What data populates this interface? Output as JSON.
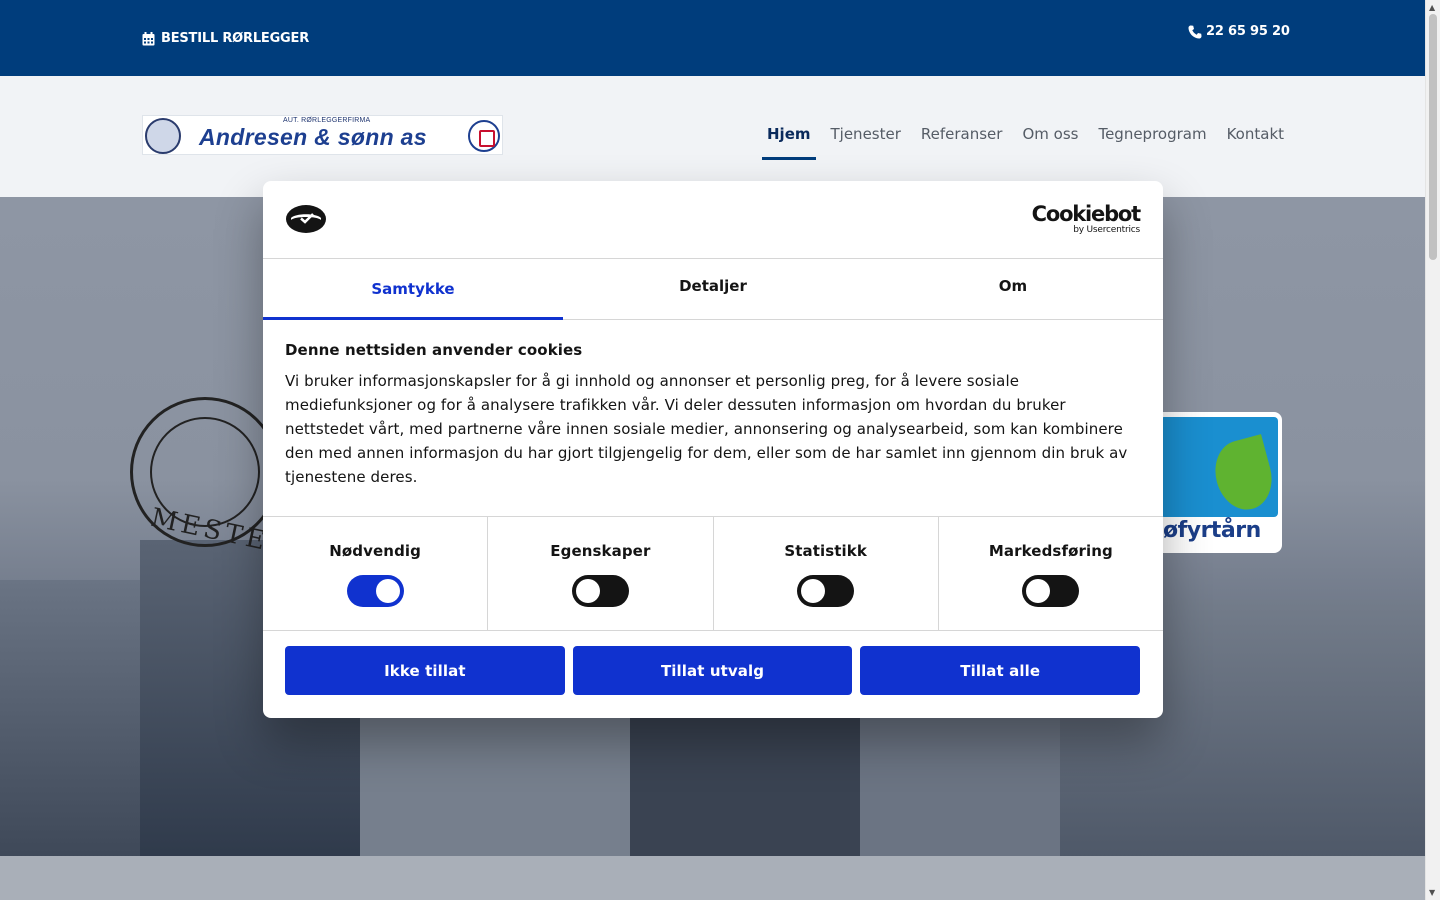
{
  "topbar": {
    "order_label": "BESTILL RØRLEGGER",
    "order_icon": "calendar-icon",
    "phone": "22 65 95 20",
    "phone_icon": "phone-icon"
  },
  "header": {
    "logo_small": "AUT. RØRLEGGERFIRMA",
    "logo_name": "Andresen & sønn as",
    "nav": [
      {
        "label": "Hjem",
        "active": true
      },
      {
        "label": "Tjenester"
      },
      {
        "label": "Referanser"
      },
      {
        "label": "Om oss"
      },
      {
        "label": "Tegneprogram"
      },
      {
        "label": "Kontakt"
      }
    ]
  },
  "hero": {
    "mester_text": "MESTE",
    "eco_text": "jøfyrtårn"
  },
  "cookie_dialog": {
    "brand": "Cookiebot",
    "brand_sub": "by Usercentrics",
    "tabs": [
      "Samtykke",
      "Detaljer",
      "Om"
    ],
    "heading": "Denne nettsiden anvender cookies",
    "text": "Vi bruker informasjonskapsler for å gi innhold og annonser et personlig preg, for å levere sosiale mediefunksjoner og for å analysere trafikken vår. Vi deler dessuten informasjon om hvordan du bruker nettstedet vårt, med partnerne våre innen sosiale medier, annonsering og analysearbeid, som kan kombinere den med annen informasjon du har gjort tilgjengelig for dem, eller som de har samlet inn gjennom din bruk av tjenestene deres.",
    "categories": [
      {
        "label": "Nødvendig",
        "on": true
      },
      {
        "label": "Egenskaper",
        "on": false
      },
      {
        "label": "Statistikk",
        "on": false
      },
      {
        "label": "Markedsføring",
        "on": false
      }
    ],
    "buttons": [
      "Ikke tillat",
      "Tillat utvalg",
      "Tillat alle"
    ]
  },
  "colors": {
    "topbar": "#003d7c",
    "accent": "#1032cf"
  }
}
